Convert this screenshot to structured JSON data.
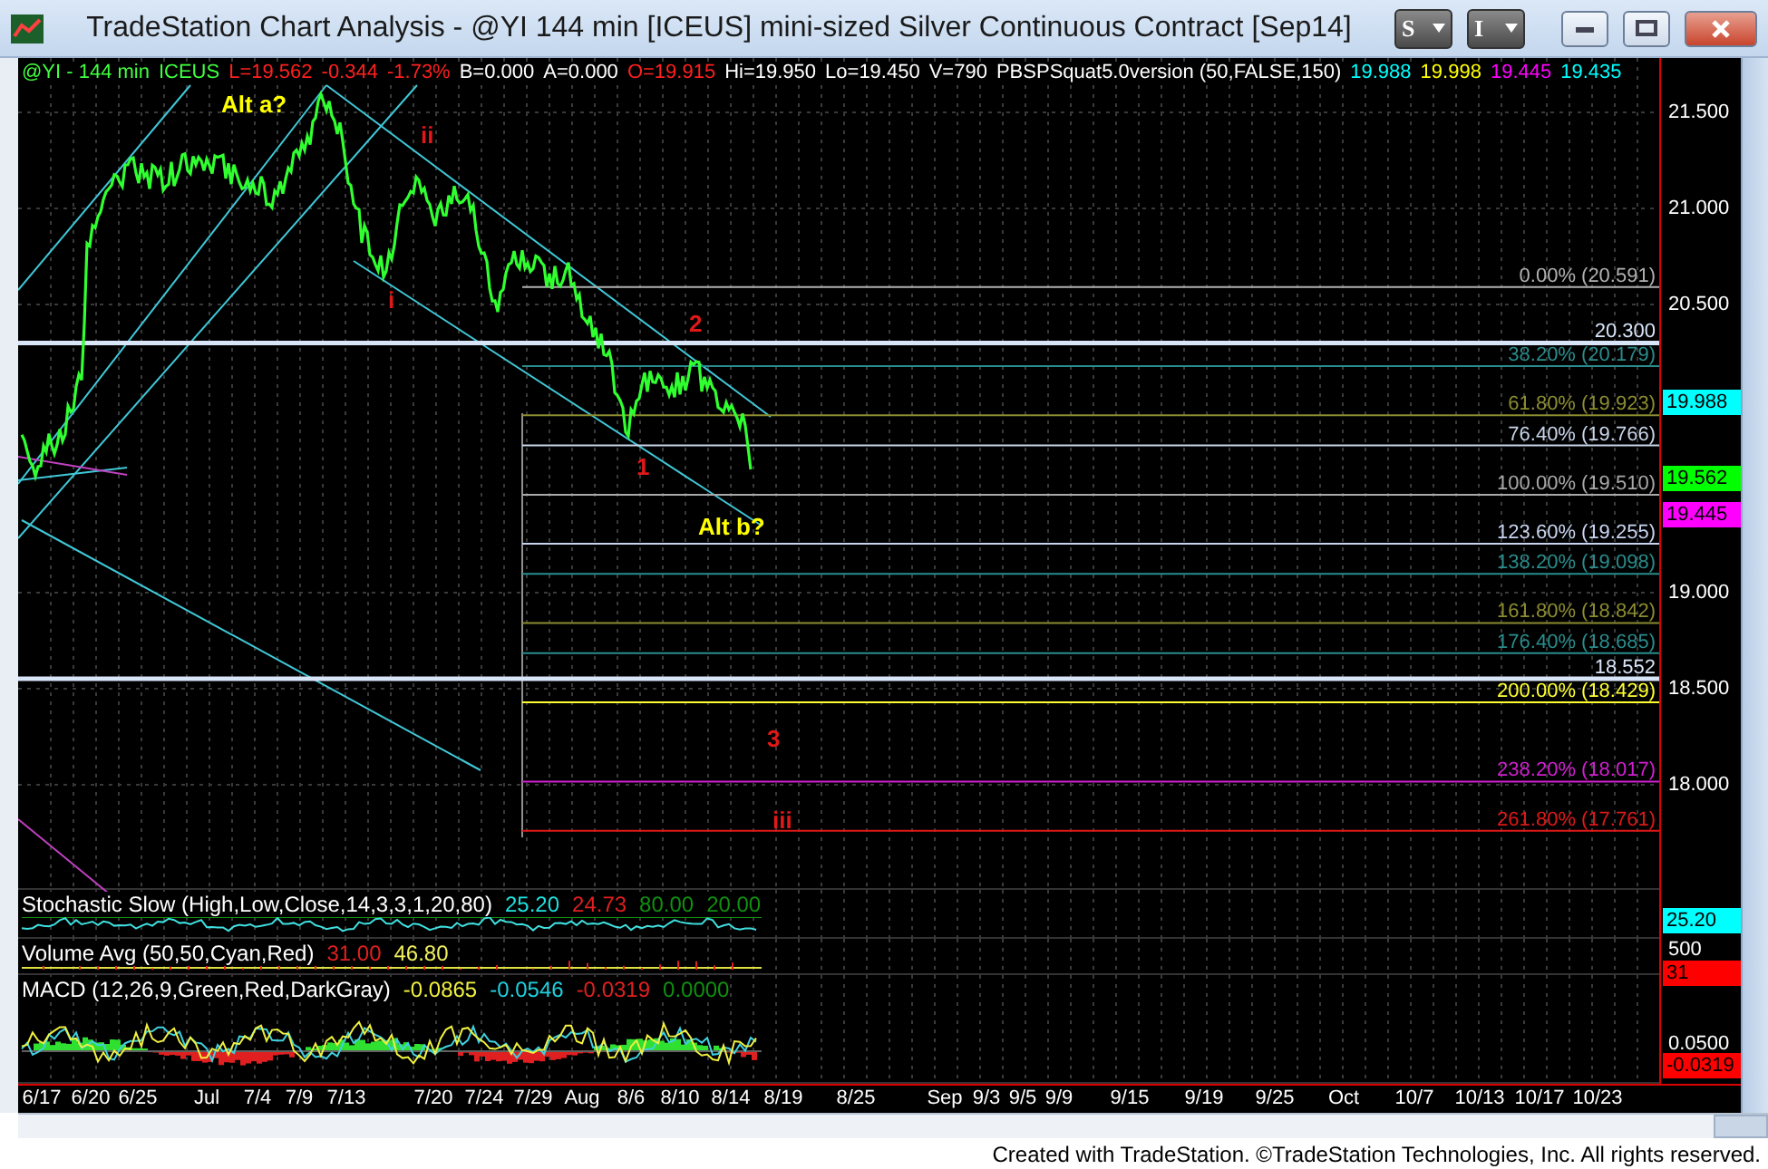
{
  "window": {
    "title": "TradeStation Chart Analysis - @YI 144 min [ICEUS] mini-sized Silver Continuous Contract [Sep14]"
  },
  "toolbar_buttons": [
    "S",
    "I"
  ],
  "info_bar": [
    {
      "text": "@YI - 144 min",
      "color": "#40ff40"
    },
    {
      "text": "ICEUS",
      "color": "#40ff40"
    },
    {
      "text": "L=19.562",
      "color": "#ff2020"
    },
    {
      "text": "-0.344",
      "color": "#ff2020"
    },
    {
      "text": "-1.73%",
      "color": "#ff2020"
    },
    {
      "text": "B=0.000",
      "color": "#ffffff"
    },
    {
      "text": "A=0.000",
      "color": "#ffffff"
    },
    {
      "text": "O=19.915",
      "color": "#ff2020"
    },
    {
      "text": "Hi=19.950",
      "color": "#ffffff"
    },
    {
      "text": "Lo=19.450",
      "color": "#ffffff"
    },
    {
      "text": "V=790",
      "color": "#ffffff"
    },
    {
      "text": "PBSPSquat5.0version (50,FALSE,150)",
      "color": "#ffffff"
    },
    {
      "text": "19.988",
      "color": "#00ffff"
    },
    {
      "text": "19.998",
      "color": "#ffff00"
    },
    {
      "text": "19.445",
      "color": "#ff00ff"
    },
    {
      "text": "19.435",
      "color": "#00ffff"
    }
  ],
  "wave_labels": [
    {
      "text": "Alt a?",
      "color": "#ffff00"
    },
    {
      "text": "ii",
      "color": "#e01818"
    },
    {
      "text": "i",
      "color": "#e01818"
    },
    {
      "text": "2",
      "color": "#e01818"
    },
    {
      "text": "1",
      "color": "#e01818"
    },
    {
      "text": "Alt b?",
      "color": "#ffff00"
    },
    {
      "text": "3",
      "color": "#e01818"
    },
    {
      "text": "iii",
      "color": "#e01818"
    }
  ],
  "fibonacci_levels": [
    {
      "label": "0.00% (20.591)",
      "color": "#b0b0b0"
    },
    {
      "label": "20.300",
      "color": "#d8e4f8"
    },
    {
      "label": "38.20% (20.179)",
      "color": "#2a8c8c"
    },
    {
      "label": "61.80% (19.923)",
      "color": "#8c8c30"
    },
    {
      "label": "76.40% (19.766)",
      "color": "#c8d4e8"
    },
    {
      "label": "100.00% (19.510)",
      "color": "#a8a8a8"
    },
    {
      "label": "123.60% (19.255)",
      "color": "#c8d4f0"
    },
    {
      "label": "138.20% (19.098)",
      "color": "#2a8c8c"
    },
    {
      "label": "161.80% (18.842)",
      "color": "#8c8c30"
    },
    {
      "label": "176.40% (18.685)",
      "color": "#2a8c8c"
    },
    {
      "label": "18.552",
      "color": "#d8e4f8"
    },
    {
      "label": "200.00% (18.429)",
      "color": "#ffff30"
    },
    {
      "label": "238.20% (18.017)",
      "color": "#d020d0"
    },
    {
      "label": "261.80% (17.761)",
      "color": "#e01818"
    }
  ],
  "price_axis": {
    "ticks": [
      "21.500",
      "21.000",
      "20.500",
      "19.000",
      "18.500",
      "18.000"
    ],
    "markers": [
      {
        "text": "19.988",
        "color": "#00ffff"
      },
      {
        "text": "19.562",
        "color": "#00ff00"
      },
      {
        "text": "19.445",
        "color": "#ff00ff"
      }
    ]
  },
  "indicators": [
    {
      "kind": "stochastic",
      "legend": [
        {
          "text": "Stochastic Slow (High,Low,Close,14,3,3,1,20,80)",
          "color": "#ffffff"
        },
        {
          "text": "25.20",
          "color": "#20e0e0"
        },
        {
          "text": "24.73",
          "color": "#e02020"
        },
        {
          "text": "80.00",
          "color": "#109010"
        },
        {
          "text": "20.00",
          "color": "#109010"
        }
      ],
      "axis": [
        {
          "text": "25.20",
          "color": "#00ffff"
        }
      ]
    },
    {
      "kind": "volume",
      "legend": [
        {
          "text": "Volume Avg (50,50,Cyan,Red)",
          "color": "#ffffff"
        },
        {
          "text": "31.00",
          "color": "#e02020"
        },
        {
          "text": "46.80",
          "color": "#f0f060"
        }
      ],
      "axis": [
        {
          "text": "500"
        },
        {
          "text": "31",
          "color": "#ff0000"
        }
      ]
    },
    {
      "kind": "macd",
      "legend": [
        {
          "text": "MACD (12,26,9,Green,Red,DarkGray)",
          "color": "#ffffff"
        },
        {
          "text": "-0.0865",
          "color": "#f0f040"
        },
        {
          "text": "-0.0546",
          "color": "#20d0e0"
        },
        {
          "text": "-0.0319",
          "color": "#e02020"
        },
        {
          "text": "0.0000",
          "color": "#109010"
        }
      ],
      "axis": [
        {
          "text": "0.0500"
        },
        {
          "text": "-0.0319",
          "color": "#ff0000"
        }
      ]
    }
  ],
  "date_axis": [
    "6/17",
    "6/20",
    "6/25",
    "Jul",
    "7/4",
    "7/9",
    "7/13",
    "7/20",
    "7/24",
    "7/29",
    "Aug",
    "8/6",
    "8/10",
    "8/14",
    "8/19",
    "8/25",
    "Sep",
    "9/3",
    "9/5",
    "9/9",
    "9/15",
    "9/19",
    "9/25",
    "Oct",
    "10/7",
    "10/13",
    "10/17",
    "10/23"
  ],
  "footer": "Created with TradeStation. ©TradeStation Technologies, Inc. All rights reserved."
}
